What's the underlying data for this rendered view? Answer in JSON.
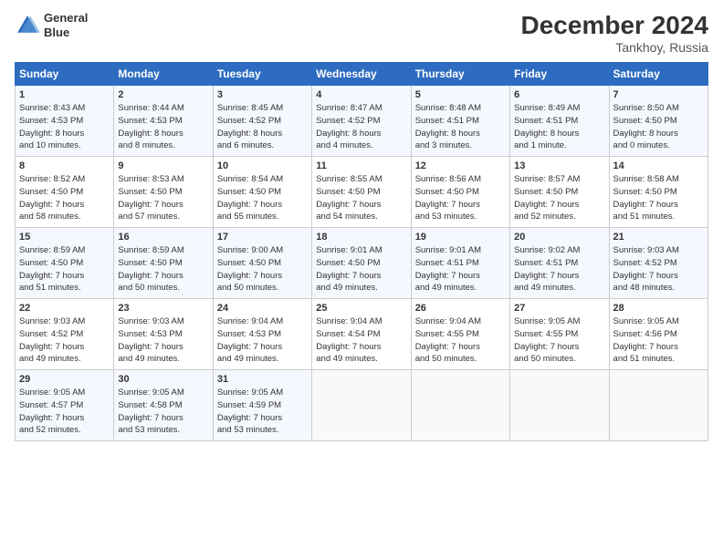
{
  "header": {
    "logo_line1": "General",
    "logo_line2": "Blue",
    "month": "December 2024",
    "location": "Tankhoy, Russia"
  },
  "days_of_week": [
    "Sunday",
    "Monday",
    "Tuesday",
    "Wednesday",
    "Thursday",
    "Friday",
    "Saturday"
  ],
  "weeks": [
    [
      {
        "day": "1",
        "info": "Sunrise: 8:43 AM\nSunset: 4:53 PM\nDaylight: 8 hours\nand 10 minutes."
      },
      {
        "day": "2",
        "info": "Sunrise: 8:44 AM\nSunset: 4:53 PM\nDaylight: 8 hours\nand 8 minutes."
      },
      {
        "day": "3",
        "info": "Sunrise: 8:45 AM\nSunset: 4:52 PM\nDaylight: 8 hours\nand 6 minutes."
      },
      {
        "day": "4",
        "info": "Sunrise: 8:47 AM\nSunset: 4:52 PM\nDaylight: 8 hours\nand 4 minutes."
      },
      {
        "day": "5",
        "info": "Sunrise: 8:48 AM\nSunset: 4:51 PM\nDaylight: 8 hours\nand 3 minutes."
      },
      {
        "day": "6",
        "info": "Sunrise: 8:49 AM\nSunset: 4:51 PM\nDaylight: 8 hours\nand 1 minute."
      },
      {
        "day": "7",
        "info": "Sunrise: 8:50 AM\nSunset: 4:50 PM\nDaylight: 8 hours\nand 0 minutes."
      }
    ],
    [
      {
        "day": "8",
        "info": "Sunrise: 8:52 AM\nSunset: 4:50 PM\nDaylight: 7 hours\nand 58 minutes."
      },
      {
        "day": "9",
        "info": "Sunrise: 8:53 AM\nSunset: 4:50 PM\nDaylight: 7 hours\nand 57 minutes."
      },
      {
        "day": "10",
        "info": "Sunrise: 8:54 AM\nSunset: 4:50 PM\nDaylight: 7 hours\nand 55 minutes."
      },
      {
        "day": "11",
        "info": "Sunrise: 8:55 AM\nSunset: 4:50 PM\nDaylight: 7 hours\nand 54 minutes."
      },
      {
        "day": "12",
        "info": "Sunrise: 8:56 AM\nSunset: 4:50 PM\nDaylight: 7 hours\nand 53 minutes."
      },
      {
        "day": "13",
        "info": "Sunrise: 8:57 AM\nSunset: 4:50 PM\nDaylight: 7 hours\nand 52 minutes."
      },
      {
        "day": "14",
        "info": "Sunrise: 8:58 AM\nSunset: 4:50 PM\nDaylight: 7 hours\nand 51 minutes."
      }
    ],
    [
      {
        "day": "15",
        "info": "Sunrise: 8:59 AM\nSunset: 4:50 PM\nDaylight: 7 hours\nand 51 minutes."
      },
      {
        "day": "16",
        "info": "Sunrise: 8:59 AM\nSunset: 4:50 PM\nDaylight: 7 hours\nand 50 minutes."
      },
      {
        "day": "17",
        "info": "Sunrise: 9:00 AM\nSunset: 4:50 PM\nDaylight: 7 hours\nand 50 minutes."
      },
      {
        "day": "18",
        "info": "Sunrise: 9:01 AM\nSunset: 4:50 PM\nDaylight: 7 hours\nand 49 minutes."
      },
      {
        "day": "19",
        "info": "Sunrise: 9:01 AM\nSunset: 4:51 PM\nDaylight: 7 hours\nand 49 minutes."
      },
      {
        "day": "20",
        "info": "Sunrise: 9:02 AM\nSunset: 4:51 PM\nDaylight: 7 hours\nand 49 minutes."
      },
      {
        "day": "21",
        "info": "Sunrise: 9:03 AM\nSunset: 4:52 PM\nDaylight: 7 hours\nand 48 minutes."
      }
    ],
    [
      {
        "day": "22",
        "info": "Sunrise: 9:03 AM\nSunset: 4:52 PM\nDaylight: 7 hours\nand 49 minutes."
      },
      {
        "day": "23",
        "info": "Sunrise: 9:03 AM\nSunset: 4:53 PM\nDaylight: 7 hours\nand 49 minutes."
      },
      {
        "day": "24",
        "info": "Sunrise: 9:04 AM\nSunset: 4:53 PM\nDaylight: 7 hours\nand 49 minutes."
      },
      {
        "day": "25",
        "info": "Sunrise: 9:04 AM\nSunset: 4:54 PM\nDaylight: 7 hours\nand 49 minutes."
      },
      {
        "day": "26",
        "info": "Sunrise: 9:04 AM\nSunset: 4:55 PM\nDaylight: 7 hours\nand 50 minutes."
      },
      {
        "day": "27",
        "info": "Sunrise: 9:05 AM\nSunset: 4:55 PM\nDaylight: 7 hours\nand 50 minutes."
      },
      {
        "day": "28",
        "info": "Sunrise: 9:05 AM\nSunset: 4:56 PM\nDaylight: 7 hours\nand 51 minutes."
      }
    ],
    [
      {
        "day": "29",
        "info": "Sunrise: 9:05 AM\nSunset: 4:57 PM\nDaylight: 7 hours\nand 52 minutes."
      },
      {
        "day": "30",
        "info": "Sunrise: 9:05 AM\nSunset: 4:58 PM\nDaylight: 7 hours\nand 53 minutes."
      },
      {
        "day": "31",
        "info": "Sunrise: 9:05 AM\nSunset: 4:59 PM\nDaylight: 7 hours\nand 53 minutes."
      },
      {
        "day": "",
        "info": ""
      },
      {
        "day": "",
        "info": ""
      },
      {
        "day": "",
        "info": ""
      },
      {
        "day": "",
        "info": ""
      }
    ]
  ]
}
